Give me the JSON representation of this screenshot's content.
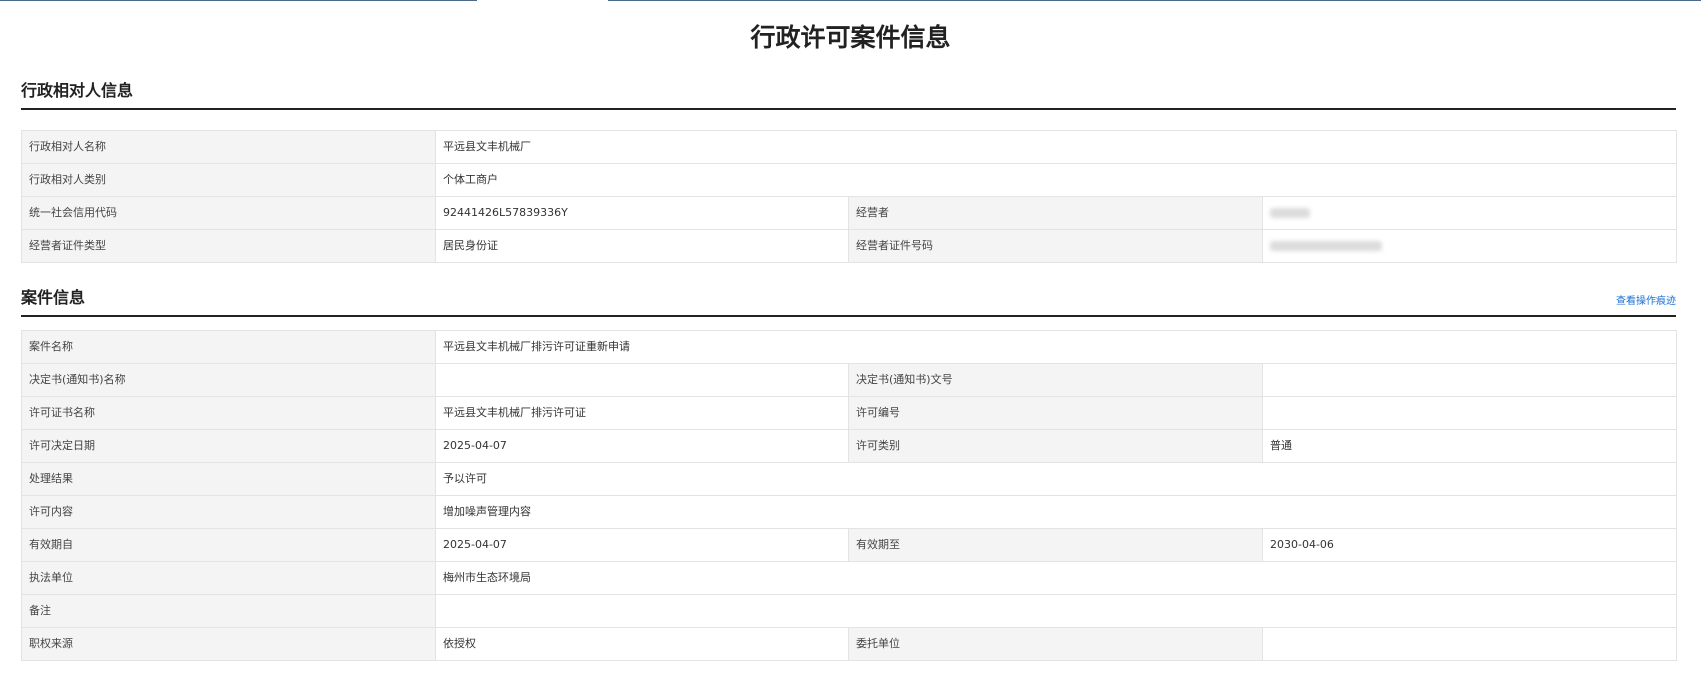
{
  "page": {
    "title": "行政许可案件信息"
  },
  "section1": {
    "title": "行政相对人信息",
    "rows": {
      "name_label": "行政相对人名称",
      "name_value": "平远县文丰机械厂",
      "category_label": "行政相对人类别",
      "category_value": "个体工商户",
      "credit_code_label": "统一社会信用代码",
      "credit_code_value": "92441426L57839336Y",
      "operator_label": "经营者",
      "id_type_label": "经营者证件类型",
      "id_type_value": "居民身份证",
      "id_number_label": "经营者证件号码"
    }
  },
  "section2": {
    "title": "案件信息",
    "link_label": "查看操作痕迹",
    "rows": {
      "case_name_label": "案件名称",
      "case_name_value": "平远县文丰机械厂排污许可证重新申请",
      "decision_name_label": "决定书(通知书)名称",
      "decision_name_value": "",
      "decision_no_label": "决定书(通知书)文号",
      "decision_no_value": "",
      "license_name_label": "许可证书名称",
      "license_name_value": "平远县文丰机械厂排污许可证",
      "license_no_label": "许可编号",
      "license_no_value": "",
      "decision_date_label": "许可决定日期",
      "decision_date_value": "2025-04-07",
      "license_type_label": "许可类别",
      "license_type_value": "普通",
      "result_label": "处理结果",
      "result_value": "予以许可",
      "content_label": "许可内容",
      "content_value": "增加噪声管理内容",
      "valid_from_label": "有效期自",
      "valid_from_value": "2025-04-07",
      "valid_to_label": "有效期至",
      "valid_to_value": "2030-04-06",
      "agency_label": "执法单位",
      "agency_value": "梅州市生态环境局",
      "remark_label": "备注",
      "remark_value": "",
      "authority_label": "职权来源",
      "authority_value": "依授权",
      "entrusted_label": "委托单位",
      "entrusted_value": ""
    }
  }
}
